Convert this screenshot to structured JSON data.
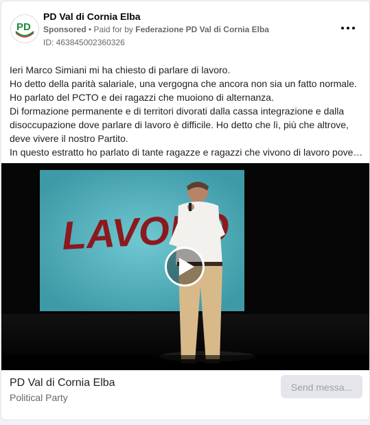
{
  "header": {
    "page_name": "PD Val di Cornia Elba",
    "sponsored": "Sponsored",
    "paid_for_prefix": " • Paid for by ",
    "paid_for_by": "Federazione PD Val di Cornia Elba",
    "ad_id": "ID: 463845002360326",
    "logo_text": "PD",
    "more_icon": "more-horizontal-icon"
  },
  "post": {
    "lines": [
      "Ieri Marco Simiani mi ha chiesto di parlare di lavoro.",
      "Ho detto della parità salariale, una vergogna che ancora non sia un fatto normale.",
      "Ho parlato del PCTO e dei ragazzi che muoiono di alternanza.",
      "Di formazione permanente e di territori divorati dalla cassa integrazione e dalla",
      "disoccupazione dove parlare di lavoro è difficile. Ho detto che lì, più che altrove,",
      "deve vivere il nostro Partito.",
      "In questo estratto ho parlato di tante ragazze e ragazzi che vivono di lavoro povero..."
    ]
  },
  "media": {
    "screen_text": "LAVORO",
    "play_icon": "play-icon"
  },
  "footer": {
    "title": "PD Val di Cornia Elba",
    "subtitle": "Political Party",
    "send_button": "Send messa..."
  },
  "colors": {
    "screen": "#5fb9c3",
    "lavoro_text": "#8b1a1f",
    "pd_green": "#1d8a3a",
    "pd_red": "#cf2027"
  }
}
